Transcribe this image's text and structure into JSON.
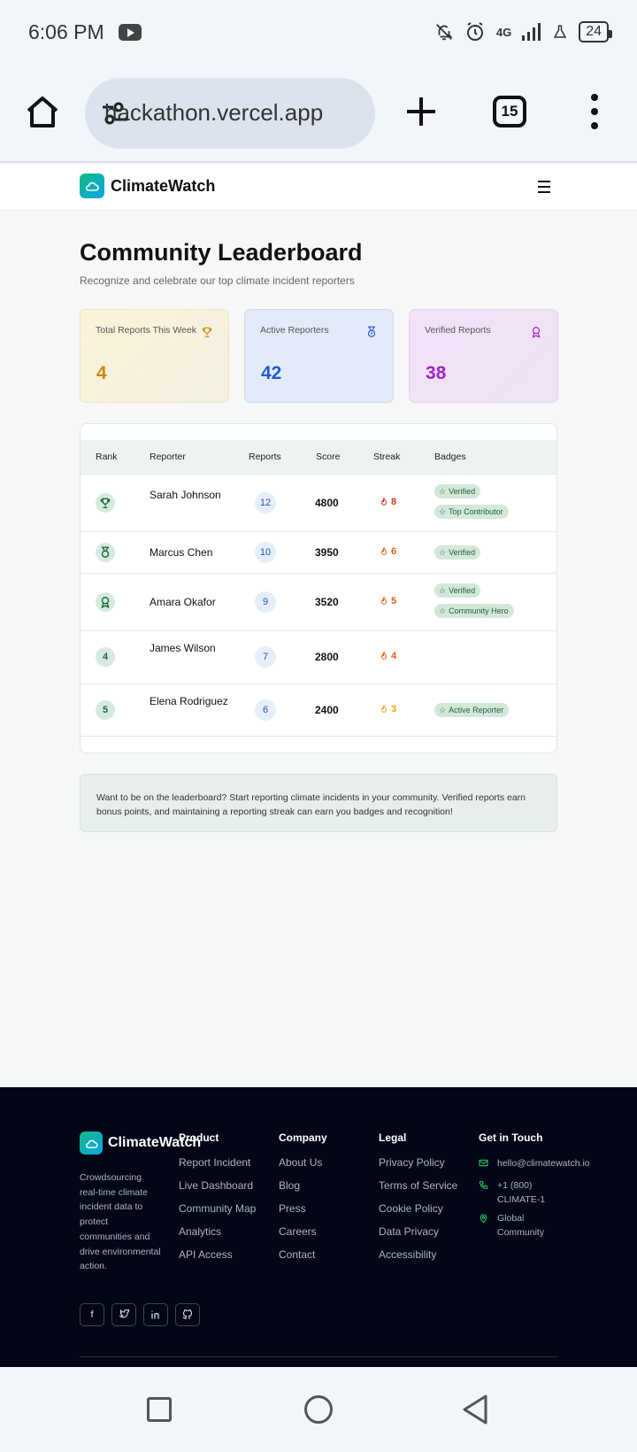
{
  "status_bar": {
    "time": "6:06 PM",
    "network": "4G",
    "battery": "24"
  },
  "browser": {
    "url": "hackathon.vercel.app",
    "tab_count": "15"
  },
  "header": {
    "brand": "ClimateWatch"
  },
  "main": {
    "title": "Community Leaderboard",
    "subtitle": "Recognize and celebrate our top climate incident reporters"
  },
  "stats": [
    {
      "label": "Total Reports This Week",
      "value": "4",
      "icon": "trophy-icon",
      "color": "#c78a0c"
    },
    {
      "label": "Active Reporters",
      "value": "42",
      "icon": "medal-icon",
      "color": "#1f5ad0"
    },
    {
      "label": "Verified Reports",
      "value": "38",
      "icon": "award-icon",
      "color": "#9c26c7"
    }
  ],
  "table": {
    "headers": [
      "Rank",
      "Reporter",
      "Reports",
      "Score",
      "Streak",
      "Badges"
    ],
    "rows": [
      {
        "rank": "1",
        "rank_icon": "trophy-icon",
        "reporter": "Sarah Johnson",
        "reports": "12",
        "score": "4800",
        "streak": "8",
        "badges": [
          "Verified",
          "Top Contributor"
        ]
      },
      {
        "rank": "2",
        "rank_icon": "medal-icon",
        "reporter": "Marcus Chen",
        "reports": "10",
        "score": "3950",
        "streak": "6",
        "badges": [
          "Verified"
        ]
      },
      {
        "rank": "3",
        "rank_icon": "award-icon",
        "reporter": "Amara Okafor",
        "reports": "9",
        "score": "3520",
        "streak": "5",
        "badges": [
          "Verified",
          "Community Hero"
        ]
      },
      {
        "rank": "4",
        "reporter": "James Wilson",
        "reports": "7",
        "score": "2800",
        "streak": "4",
        "badges": []
      },
      {
        "rank": "5",
        "reporter": "Elena Rodriguez",
        "reports": "6",
        "score": "2400",
        "streak": "3",
        "badges": [
          "Active Reporter"
        ]
      }
    ]
  },
  "info_text": "Want to be on the leaderboard? Start reporting climate incidents in your community. Verified reports earn bonus points, and maintaining a reporting streak can earn you badges and recognition!",
  "footer": {
    "brand": "ClimateWatch",
    "description": "Crowdsourcing real-time climate incident data to protect communities and drive environmental action.",
    "columns": [
      {
        "heading": "Product",
        "links": [
          "Report Incident",
          "Live Dashboard",
          "Community Map",
          "Analytics",
          "API Access"
        ]
      },
      {
        "heading": "Company",
        "links": [
          "About Us",
          "Blog",
          "Press",
          "Careers",
          "Contact"
        ]
      },
      {
        "heading": "Legal",
        "links": [
          "Privacy Policy",
          "Terms of Service",
          "Cookie Policy",
          "Data Privacy",
          "Accessibility"
        ]
      }
    ],
    "contact": {
      "heading": "Get in Touch",
      "email": "hello@climatewatch.io",
      "phone": "+1 (800) CLIMATE-1",
      "location": "Global Community"
    },
    "socials": [
      "facebook-icon",
      "twitter-icon",
      "linkedin-icon",
      "github-icon"
    ]
  }
}
